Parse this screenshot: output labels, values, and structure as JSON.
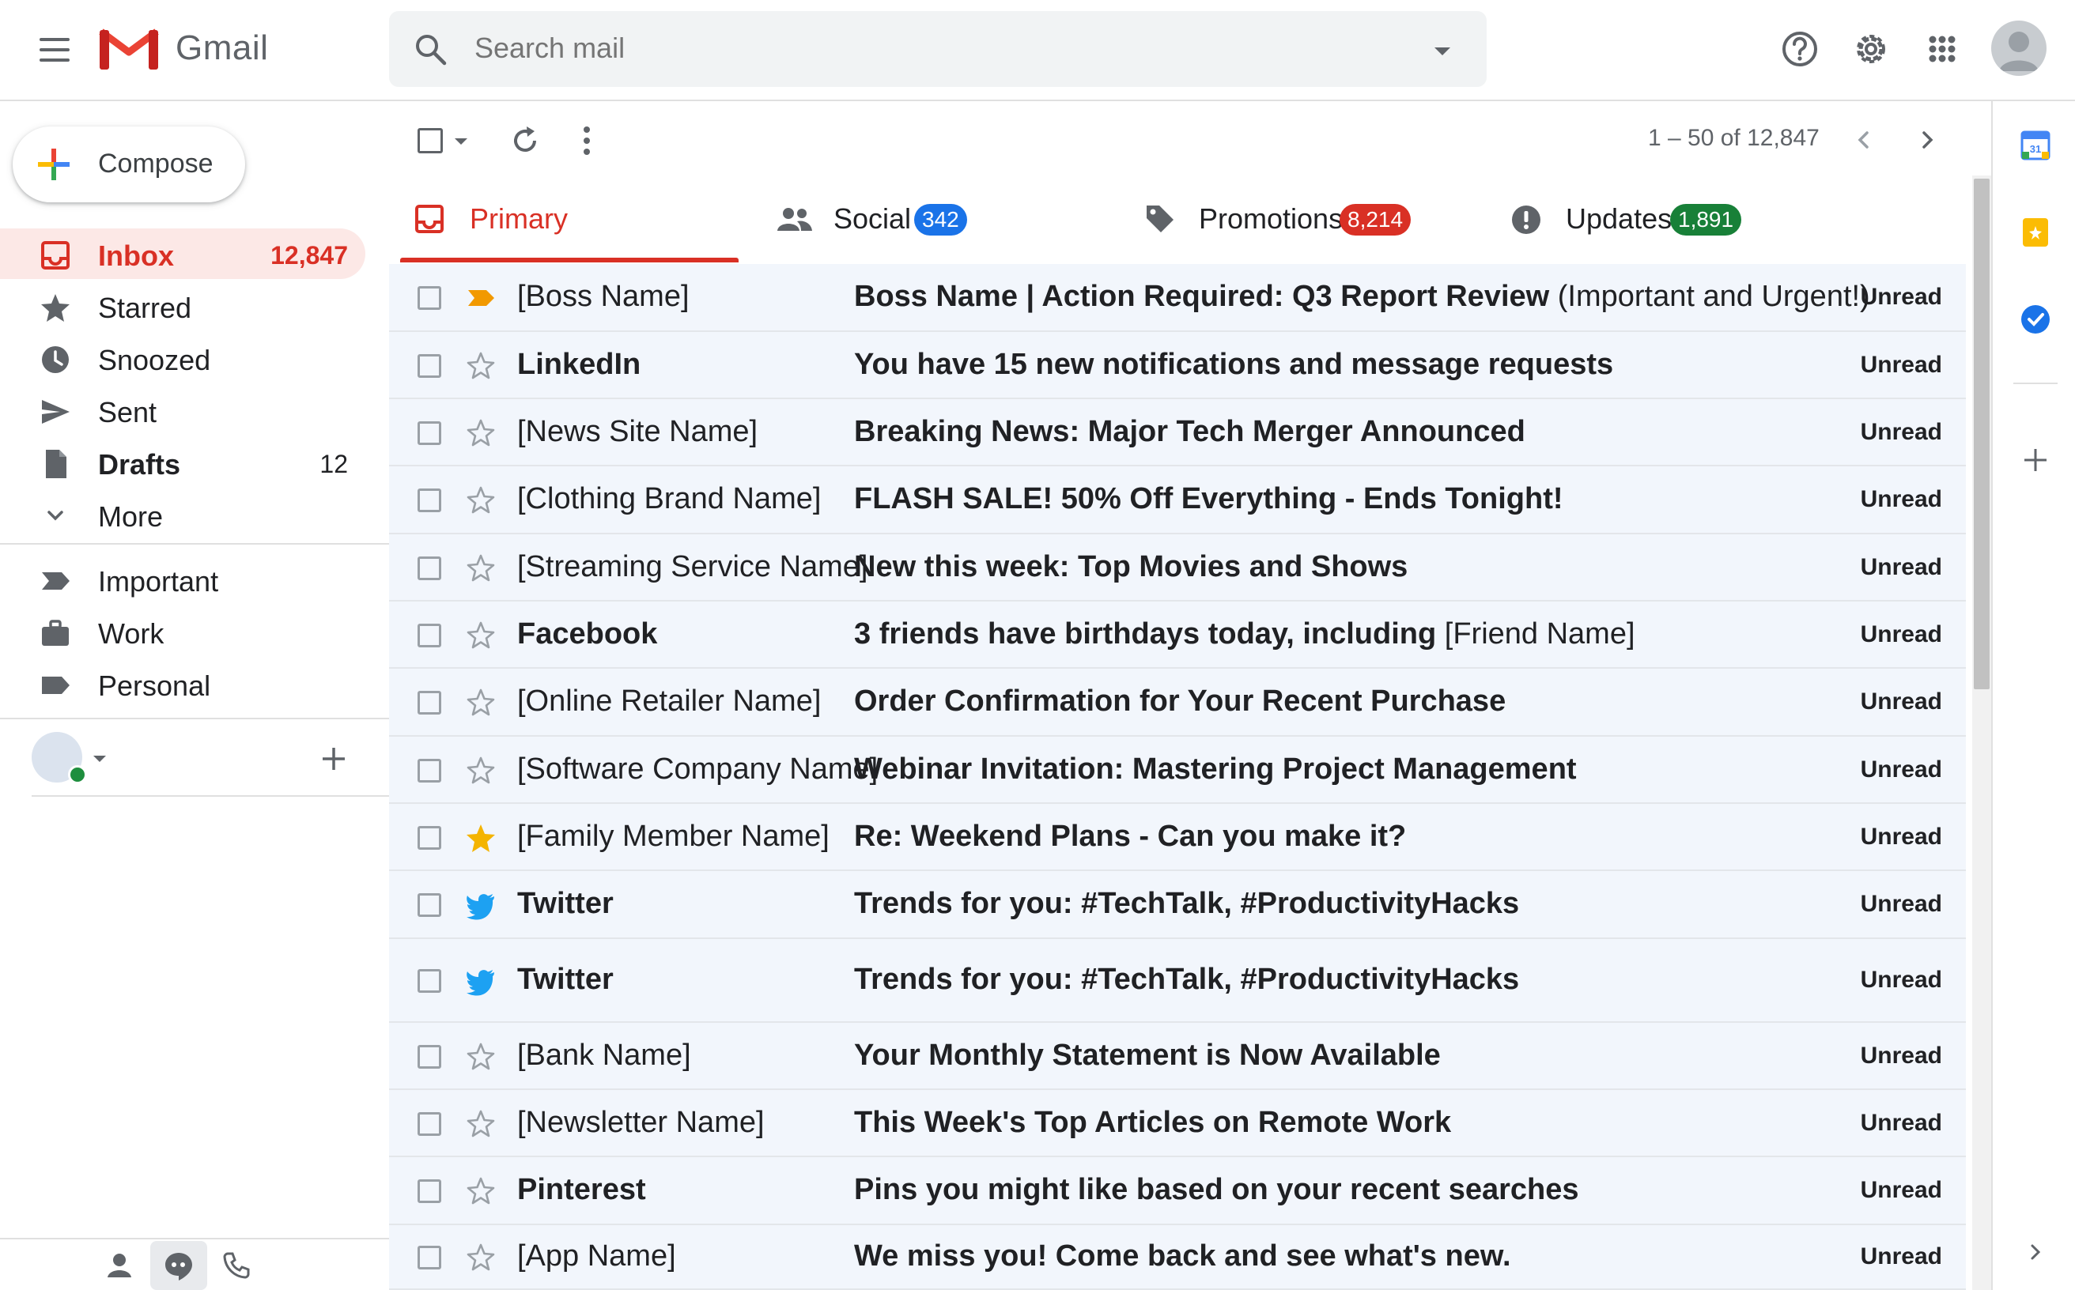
{
  "app": {
    "name": "Gmail",
    "search_placeholder": "Search mail"
  },
  "compose_label": "Compose",
  "nav": {
    "primary": [
      {
        "label": "Inbox",
        "count": "12,847",
        "icon": "inbox-icon"
      },
      {
        "label": "Starred",
        "count": "",
        "icon": "star-icon"
      },
      {
        "label": "Snoozed",
        "count": "",
        "icon": "clock-icon"
      },
      {
        "label": "Sent",
        "count": "",
        "icon": "send-icon"
      },
      {
        "label": "Drafts",
        "count": "12",
        "icon": "draft-icon"
      },
      {
        "label": "More",
        "count": "",
        "icon": "chevron-down-icon"
      }
    ],
    "labels": [
      {
        "label": "Important",
        "icon": "important-label-icon"
      },
      {
        "label": "Work",
        "icon": "briefcase-icon"
      },
      {
        "label": "Personal",
        "icon": "label-icon"
      }
    ]
  },
  "toolbar": {
    "pagination": "1 – 50 of 12,847"
  },
  "tabs": [
    {
      "label": "Primary",
      "badge": "",
      "icon": "inbox-icon"
    },
    {
      "label": "Social",
      "badge": "342",
      "badge_color": "#1a73e8",
      "icon": "people-icon"
    },
    {
      "label": "Promotions",
      "badge": "8,214",
      "badge_color": "#d93025",
      "icon": "tag-icon"
    },
    {
      "label": "Updates",
      "badge": "1,891",
      "badge_color": "#188038",
      "icon": "info-icon"
    }
  ],
  "emails": [
    {
      "sender": "[Boss Name]",
      "sender_bold": false,
      "subject_bold": "Boss Name | Action Required: Q3 Report Review",
      "subject_rest": " (Important and Urgent!)",
      "status": "Unread",
      "mark": "important"
    },
    {
      "sender": "LinkedIn",
      "sender_bold": true,
      "subject_bold": "You have 15 new notifications and message requests",
      "subject_rest": "",
      "status": "Unread",
      "mark": "star"
    },
    {
      "sender": "[News Site Name]",
      "sender_bold": false,
      "subject_bold": "Breaking News: Major Tech Merger Announced",
      "subject_rest": "",
      "status": "Unread",
      "mark": "star"
    },
    {
      "sender": "[Clothing Brand Name]",
      "sender_bold": false,
      "subject_bold": "FLASH SALE! 50% Off Everything - Ends Tonight!",
      "subject_rest": "",
      "status": "Unread",
      "mark": "star"
    },
    {
      "sender": "[Streaming Service Name]",
      "sender_bold": false,
      "subject_bold": "New this week: Top Movies and Shows",
      "subject_rest": "",
      "status": "Unread",
      "mark": "star"
    },
    {
      "sender": "Facebook",
      "sender_bold": true,
      "subject_bold": "3 friends have birthdays today, including",
      "subject_rest": " [Friend Name]",
      "status": "Unread",
      "mark": "star"
    },
    {
      "sender": "[Online Retailer Name]",
      "sender_bold": false,
      "subject_bold": "Order Confirmation for Your Recent Purchase",
      "subject_rest": "",
      "status": "Unread",
      "mark": "star"
    },
    {
      "sender": "[Software Company Name]",
      "sender_bold": false,
      "subject_bold": "Webinar Invitation: Mastering Project Management",
      "subject_rest": "",
      "status": "Unread",
      "mark": "star"
    },
    {
      "sender": "[Family Member Name]",
      "sender_bold": false,
      "subject_bold": "Re: Weekend Plans - Can you make it?",
      "subject_rest": "",
      "status": "Unread",
      "mark": "star-filled"
    },
    {
      "sender": "Twitter",
      "sender_bold": true,
      "subject_bold": "Trends for you: #TechTalk, #ProductivityHacks",
      "subject_rest": "",
      "status": "Unread",
      "mark": "twitter"
    },
    {
      "sender": "Twitter",
      "sender_bold": true,
      "subject_bold": "Trends for you: #TechTalk, #ProductivityHacks",
      "subject_rest": "",
      "status": "Unread",
      "mark": "twitter"
    },
    {
      "sender": "[Bank Name]",
      "sender_bold": false,
      "subject_bold": "Your Monthly Statement is Now Available",
      "subject_rest": "",
      "status": "Unread",
      "mark": "star"
    },
    {
      "sender": "[Newsletter Name]",
      "sender_bold": false,
      "subject_bold": "This Week's Top Articles on Remote Work",
      "subject_rest": "",
      "status": "Unread",
      "mark": "star"
    },
    {
      "sender": "Pinterest",
      "sender_bold": true,
      "subject_bold": "Pins you might like based on your recent searches",
      "subject_rest": "",
      "status": "Unread",
      "mark": "star"
    },
    {
      "sender": "[App Name]",
      "sender_bold": false,
      "subject_bold": "We miss you! Come back and see what's new.",
      "subject_rest": "",
      "status": "Unread",
      "mark": "star"
    }
  ],
  "colors": {
    "accent": "#d93025",
    "row_bg": "#f2f6fc",
    "important": "#f29900",
    "star_filled": "#f4b400",
    "twitter": "#1da1f2"
  }
}
